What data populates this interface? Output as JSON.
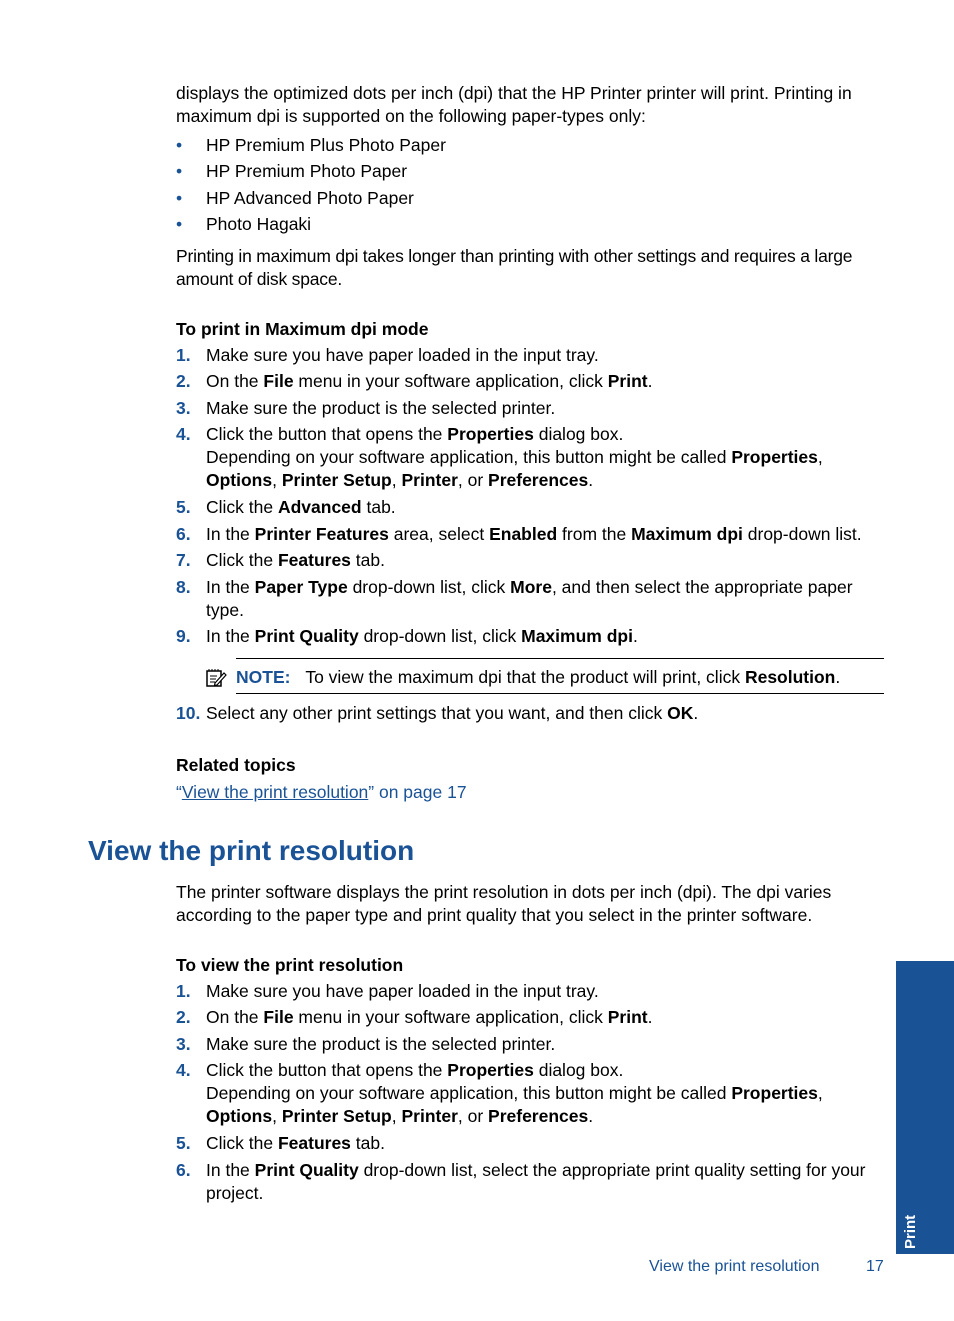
{
  "intro": {
    "paragraph1": "displays the optimized dots per inch (dpi) that the HP Printer printer will print. Printing in maximum dpi is supported on the following paper-types only:",
    "paper_types": [
      "HP Premium Plus Photo Paper",
      "HP Premium Photo Paper",
      "HP Advanced Photo Paper",
      "Photo Hagaki"
    ],
    "bullet_glyph": "•",
    "paragraph2": "Printing in maximum dpi takes longer than printing with other settings and requires a large amount of disk space."
  },
  "max_dpi_procedure": {
    "title": "To print in Maximum dpi mode",
    "steps": [
      {
        "num": "1.",
        "parts": [
          [
            "Make sure you have paper loaded in the input tray.",
            false
          ]
        ]
      },
      {
        "num": "2.",
        "parts": [
          [
            "On the ",
            false
          ],
          [
            "File",
            true
          ],
          [
            " menu in your software application, click ",
            false
          ],
          [
            "Print",
            true
          ],
          [
            ".",
            false
          ]
        ]
      },
      {
        "num": "3.",
        "parts": [
          [
            "Make sure the product is the selected printer.",
            false
          ]
        ]
      },
      {
        "num": "4.",
        "parts": [
          [
            "Click the button that opens the ",
            false
          ],
          [
            "Properties",
            true
          ],
          [
            " dialog box.",
            false
          ]
        ],
        "extra": [
          [
            "Depending on your software application, this button might be called ",
            false
          ],
          [
            "Properties",
            true
          ],
          [
            ", ",
            false
          ],
          [
            "Options",
            true
          ],
          [
            ", ",
            false
          ],
          [
            "Printer Setup",
            true
          ],
          [
            ", ",
            false
          ],
          [
            "Printer",
            true
          ],
          [
            ", or ",
            false
          ],
          [
            "Preferences",
            true
          ],
          [
            ".",
            false
          ]
        ]
      },
      {
        "num": "5.",
        "parts": [
          [
            "Click the ",
            false
          ],
          [
            "Advanced",
            true
          ],
          [
            " tab.",
            false
          ]
        ]
      },
      {
        "num": "6.",
        "parts": [
          [
            "In the ",
            false
          ],
          [
            "Printer Features",
            true
          ],
          [
            " area, select ",
            false
          ],
          [
            "Enabled",
            true
          ],
          [
            " from the ",
            false
          ],
          [
            "Maximum dpi",
            true
          ],
          [
            " drop-down list.",
            false
          ]
        ]
      },
      {
        "num": "7.",
        "parts": [
          [
            "Click the ",
            false
          ],
          [
            "Features",
            true
          ],
          [
            " tab.",
            false
          ]
        ]
      },
      {
        "num": "8.",
        "parts": [
          [
            "In the ",
            false
          ],
          [
            "Paper Type",
            true
          ],
          [
            " drop-down list, click ",
            false
          ],
          [
            "More",
            true
          ],
          [
            ", and then select the appropriate paper type.",
            false
          ]
        ]
      },
      {
        "num": "9.",
        "parts": [
          [
            "In the ",
            false
          ],
          [
            "Print Quality",
            true
          ],
          [
            " drop-down list, click ",
            false
          ],
          [
            "Maximum dpi",
            true
          ],
          [
            ".",
            false
          ]
        ]
      },
      {
        "num": "10.",
        "parts": [
          [
            "Select any other print settings that you want, and then click ",
            false
          ],
          [
            "OK",
            true
          ],
          [
            ".",
            false
          ]
        ]
      }
    ],
    "note": {
      "label": "NOTE:",
      "parts": [
        [
          "To view the maximum dpi that the product will print, click ",
          false
        ],
        [
          "Resolution",
          true
        ],
        [
          ".",
          false
        ]
      ]
    }
  },
  "related": {
    "title": "Related topics",
    "link_open_quote": "“",
    "link_text": "View the print resolution",
    "link_suffix": "” on page 17"
  },
  "section": {
    "heading": "View the print resolution",
    "paragraph": "The printer software displays the print resolution in dots per inch (dpi). The dpi varies according to the paper type and print quality that you select in the printer software.",
    "procedure_title": "To view the print resolution",
    "steps": [
      {
        "num": "1.",
        "parts": [
          [
            "Make sure you have paper loaded in the input tray.",
            false
          ]
        ]
      },
      {
        "num": "2.",
        "parts": [
          [
            "On the ",
            false
          ],
          [
            "File",
            true
          ],
          [
            " menu in your software application, click ",
            false
          ],
          [
            "Print",
            true
          ],
          [
            ".",
            false
          ]
        ]
      },
      {
        "num": "3.",
        "parts": [
          [
            "Make sure the product is the selected printer.",
            false
          ]
        ]
      },
      {
        "num": "4.",
        "parts": [
          [
            "Click the button that opens the ",
            false
          ],
          [
            "Properties",
            true
          ],
          [
            " dialog box.",
            false
          ]
        ],
        "extra": [
          [
            "Depending on your software application, this button might be called ",
            false
          ],
          [
            "Properties",
            true
          ],
          [
            ", ",
            false
          ],
          [
            "Options",
            true
          ],
          [
            ", ",
            false
          ],
          [
            "Printer Setup",
            true
          ],
          [
            ", ",
            false
          ],
          [
            "Printer",
            true
          ],
          [
            ", or ",
            false
          ],
          [
            "Preferences",
            true
          ],
          [
            ".",
            false
          ]
        ]
      },
      {
        "num": "5.",
        "parts": [
          [
            "Click the ",
            false
          ],
          [
            "Features",
            true
          ],
          [
            " tab.",
            false
          ]
        ]
      },
      {
        "num": "6.",
        "parts": [
          [
            "In the ",
            false
          ],
          [
            "Print Quality",
            true
          ],
          [
            " drop-down list, select the appropriate print quality setting for your project.",
            false
          ]
        ]
      }
    ]
  },
  "side_tab": {
    "label": "Print",
    "color": "#1a5296"
  },
  "footer": {
    "section_title": "View the print resolution",
    "page_number": "17"
  },
  "colors": {
    "accent": "#1a5296",
    "text": "#000000"
  }
}
